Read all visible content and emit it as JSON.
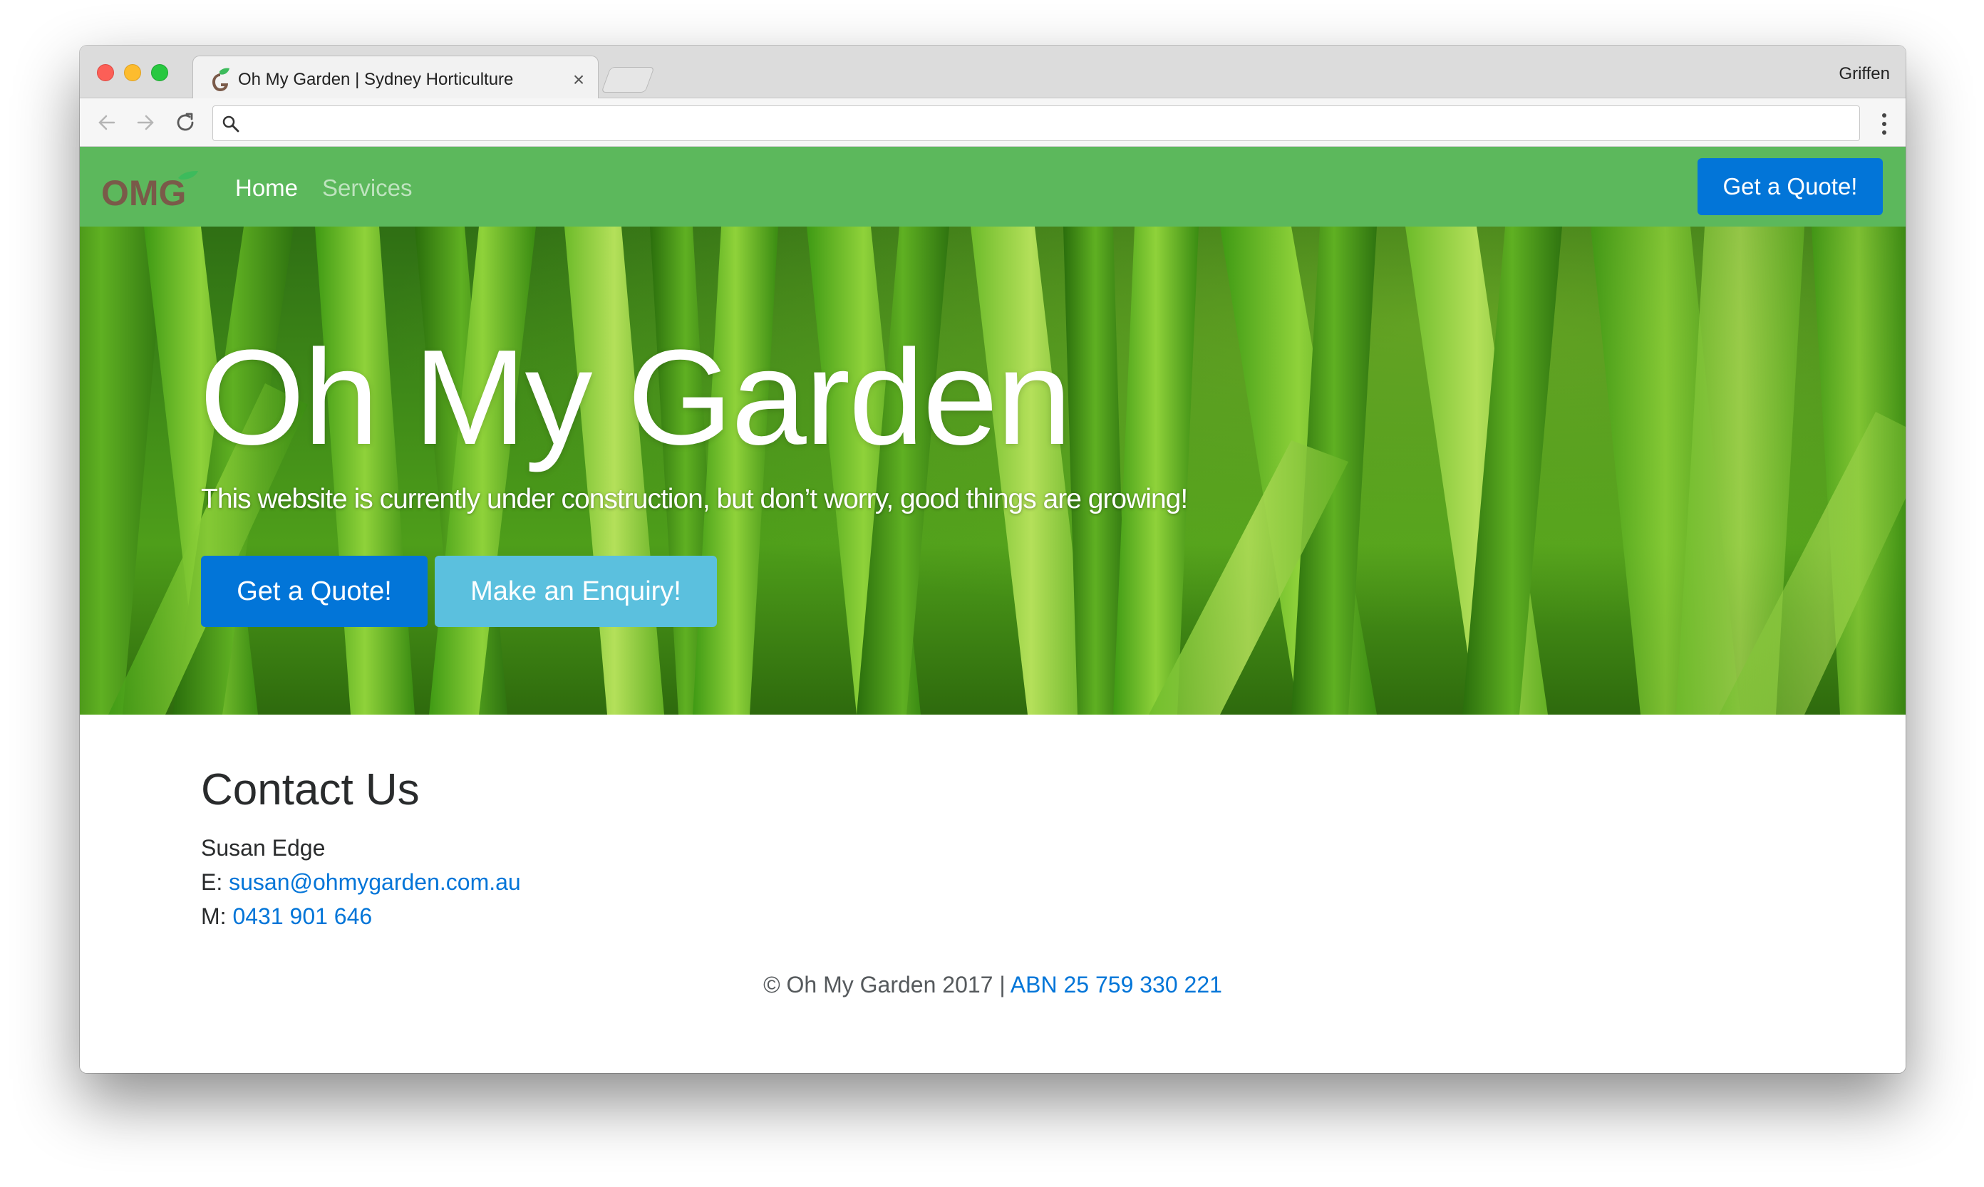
{
  "browser": {
    "tab_title": "Oh My Garden | Sydney Horticulture",
    "tab_close": "×",
    "profile_name": "Griffen",
    "address_value": "",
    "address_placeholder": ""
  },
  "navbar": {
    "logo_text": "OMG",
    "links": [
      {
        "label": "Home",
        "active": true
      },
      {
        "label": "Services",
        "active": false
      }
    ],
    "cta_label": "Get a Quote!"
  },
  "hero": {
    "title": "Oh My Garden",
    "lead": "This website is currently under construction, but don’t worry, good things are growing!",
    "primary_button": "Get a Quote!",
    "secondary_button": "Make an Enquiry!"
  },
  "contact": {
    "heading": "Contact Us",
    "name": "Susan Edge",
    "email_prefix": "E: ",
    "email": "susan@ohmygarden.com.au",
    "mobile_prefix": "M: ",
    "mobile": "0431 901 646"
  },
  "footer": {
    "copyright": "© Oh My Garden 2017 | ",
    "abn": "ABN 25 759 330 221"
  },
  "colors": {
    "navbar_green": "#5cb85c",
    "primary_blue": "#0275d8",
    "info_blue": "#5bc0de",
    "logo_brown": "#7a5a49",
    "logo_leaf_green": "#3dbb5c"
  }
}
